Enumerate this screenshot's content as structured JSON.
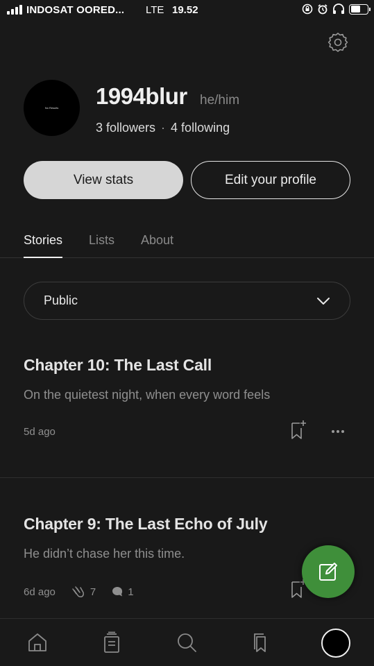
{
  "status_bar": {
    "carrier": "INDOSAT OORED...",
    "network": "LTE",
    "time": "19.52"
  },
  "profile": {
    "avatar_text": "No Results",
    "username": "1994blur",
    "pronouns": "he/him",
    "followers": "3 followers",
    "separator": "·",
    "following": "4 following"
  },
  "actions": {
    "view_stats": "View stats",
    "edit_profile": "Edit your profile"
  },
  "tabs": [
    {
      "label": "Stories",
      "active": true
    },
    {
      "label": "Lists",
      "active": false
    },
    {
      "label": "About",
      "active": false
    }
  ],
  "filter": {
    "selected": "Public"
  },
  "stories": [
    {
      "title": "Chapter 10: The Last Call",
      "excerpt": "On the quietest night, when every word feels",
      "time_ago": "5d ago"
    },
    {
      "title": "Chapter 9: The Last Echo of July",
      "excerpt": "He didn’t chase her this time.",
      "time_ago": "6d ago",
      "claps": "7",
      "responses": "1"
    }
  ],
  "colors": {
    "background": "#191919",
    "fab": "#3f8f3a",
    "primary_button": "#d6d6d6",
    "muted_text": "#8f8f8f"
  },
  "icons": {
    "settings": "gear-icon",
    "chevron": "chevron-down-icon",
    "bookmark": "bookmark-add-icon",
    "more": "more-horizontal-icon",
    "clap": "clap-icon",
    "response": "comment-icon",
    "write": "write-icon",
    "nav": [
      "home-icon",
      "library-icon",
      "search-icon",
      "bookmarks-icon",
      "profile-avatar"
    ]
  }
}
